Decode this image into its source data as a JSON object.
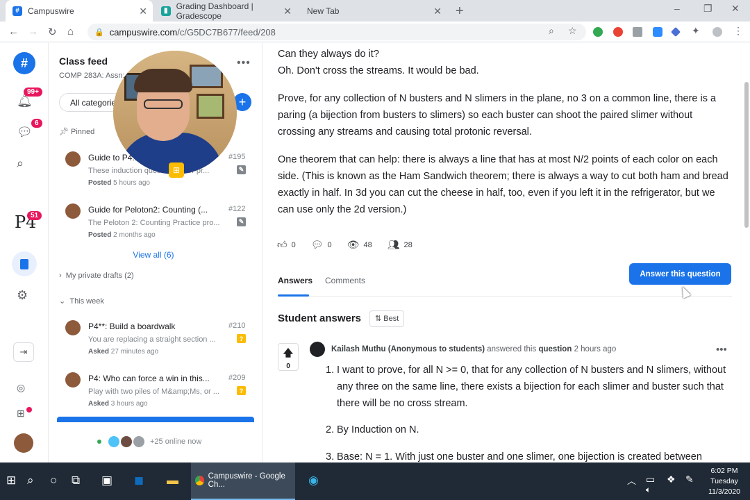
{
  "browser": {
    "tabs": [
      {
        "title": "Campuswire",
        "active": true
      },
      {
        "title": "Grading Dashboard | Gradescope",
        "active": false
      },
      {
        "title": "New Tab",
        "active": false
      }
    ],
    "url_host": "campuswire.com",
    "url_path": "/c/G5DC7B677/feed/208",
    "extension_badge": "2"
  },
  "rail": {
    "notification_badge": "99+",
    "messages_badge": "6",
    "p4_label": "P4",
    "p4_badge": "51"
  },
  "feed": {
    "title": "Class feed",
    "subtitle": "COMP 283A: Assn: D...",
    "category_button": "All categories",
    "pinned_label": "Pinned",
    "pinned_posts": [
      {
        "title": "Guide to P4...",
        "number": "#195",
        "preview": "These induction questions... for pr...",
        "meta_label": "Posted",
        "meta_time": "5 hours ago"
      },
      {
        "title": "Guide for Peloton2: Counting (...",
        "number": "#122",
        "preview": "The Peloton 2: Counting Practice pro...",
        "meta_label": "Posted",
        "meta_time": "2 months ago"
      }
    ],
    "view_all": "View all (6)",
    "drafts_label": "My private drafts",
    "drafts_count": "(2)",
    "this_week_label": "This week",
    "week_posts": [
      {
        "title": "P4**: Build a boardwalk",
        "number": "#210",
        "preview": "You are replacing a straight section ...",
        "meta_label": "Asked",
        "meta_time": "27 minutes ago",
        "icon": "?"
      },
      {
        "title": "P4: Who can force a win in this...",
        "number": "#209",
        "preview": "Play with two piles of M&amp;Ms, or ...",
        "meta_label": "Asked",
        "meta_time": "3 hours ago",
        "icon": "?"
      }
    ],
    "online_text": "+25 online now"
  },
  "question": {
    "lines": [
      "Can they always do it?",
      "Oh. Don't cross the streams.  It would be bad."
    ],
    "para1": "Prove, for any collection of N busters and N slimers in the plane, no 3 on a common line, there is a paring (a bijection from busters to slimers) so each buster can shoot the paired slimer without crossing any streams and causing total protonic reversal.",
    "para2": "One theorem that can help: there is always a line that has at most N/2 points of each color on each side. (This is known as the Ham Sandwich theorem; there is always a way to cut both ham and bread exactly in half.  In 3d you can cut the cheese in half, too, even if you left it in the refrigerator, but we can use only the 2d version.)",
    "stats": {
      "likes": "0",
      "comments": "0",
      "views": "48",
      "participants": "28"
    },
    "tab_answers": "Answers",
    "tab_comments": "Comments",
    "answer_button": "Answer this question"
  },
  "answers": {
    "title": "Student answers",
    "sort_label": "Best",
    "vote_count": "0",
    "author": "Kailash Muthu (Anonymous to students)",
    "verb": "answered this",
    "object": "question",
    "time": "2 hours ago",
    "items": [
      {
        "num": "1.",
        "text": "I want to prove, for all N >= 0, that for any collection of N busters and N slimers, without any three on the same line, there exists a bijection for each slimer and buster such that there will be no cross stream."
      },
      {
        "num": "2.",
        "text": "By Induction on N."
      },
      {
        "num": "3.",
        "text": "Base: N = 1. With just one buster and one slimer, one bijection is created between"
      }
    ]
  },
  "taskbar": {
    "active_app": "Campuswire - Google Ch...",
    "time": "6:02 PM",
    "day": "Tuesday",
    "date": "11/3/2020"
  },
  "colors": {
    "accent": "#1a73e8",
    "badge": "#e8175d",
    "taskbar": "#1f2a36"
  }
}
